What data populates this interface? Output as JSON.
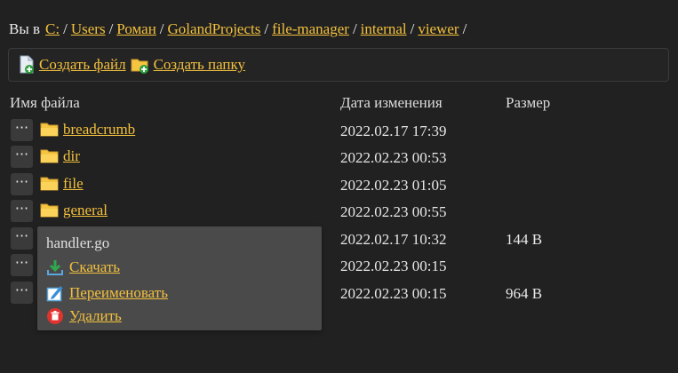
{
  "breadcrumb": {
    "prefix": "Вы в",
    "separator": "/",
    "items": [
      "C:",
      "Users",
      "Роман",
      "GolandProjects",
      "file-manager",
      "internal",
      "viewer"
    ]
  },
  "toolbar": {
    "create_file_label": "Создать файл",
    "create_folder_label": "Создать папку"
  },
  "table": {
    "headers": [
      "Имя файла",
      "Дата изменения",
      "Размер"
    ],
    "row_menu_label": "···",
    "rows": [
      {
        "name": "breadcrumb",
        "type": "folder",
        "date": "2022.02.17 17:39",
        "size": ""
      },
      {
        "name": "dir",
        "type": "folder",
        "date": "2022.02.23 00:53",
        "size": ""
      },
      {
        "name": "file",
        "type": "folder",
        "date": "2022.02.23 01:05",
        "size": ""
      },
      {
        "name": "general",
        "type": "folder",
        "date": "2022.02.23 00:55",
        "size": ""
      },
      {
        "name": "",
        "type": "file",
        "date": "2022.02.17 10:32",
        "size": "144 B"
      },
      {
        "name": "",
        "type": "file",
        "date": "2022.02.23 00:15",
        "size": ""
      },
      {
        "name": "",
        "type": "file",
        "date": "2022.02.23 00:15",
        "size": "964 B"
      }
    ]
  },
  "context_menu": {
    "title": "handler.go",
    "download_label": "Скачать",
    "rename_label": "Переименовать",
    "delete_label": "Удалить"
  },
  "colors": {
    "background": "#212121",
    "link": "#f2c03d",
    "popup": "#4a4a4a"
  }
}
